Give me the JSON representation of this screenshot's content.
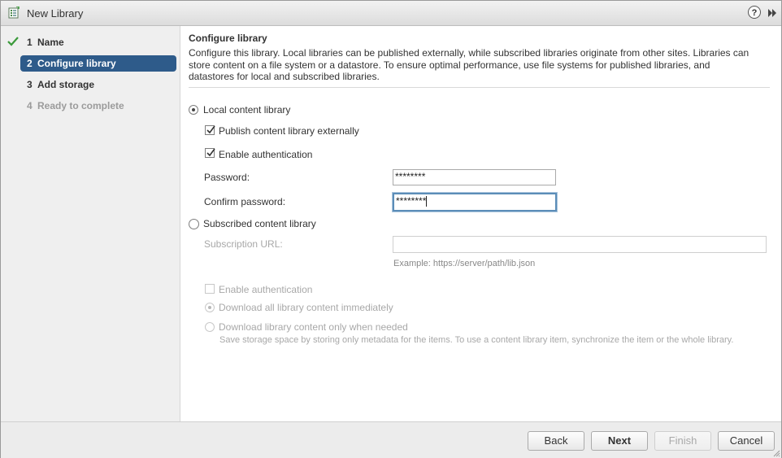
{
  "window": {
    "title": "New Library",
    "help_label": "?"
  },
  "steps": [
    {
      "num": "1",
      "label": "Name"
    },
    {
      "num": "2",
      "label": "Configure library"
    },
    {
      "num": "3",
      "label": "Add storage"
    },
    {
      "num": "4",
      "label": "Ready to complete"
    }
  ],
  "main": {
    "section_title": "Configure library",
    "description": "Configure this library. Local libraries can be published externally, while subscribed libraries originate from other sites. Libraries can store content on a file system or a datastore. To ensure optimal performance, use file systems for published libraries, and datastores for local and subscribed libraries.",
    "local": {
      "label": "Local content library",
      "selected": true,
      "publish_label": "Publish content library externally",
      "publish_checked": true,
      "auth_label": "Enable authentication",
      "auth_checked": true,
      "password_label": "Password:",
      "password_value": "********",
      "confirm_label": "Confirm password:",
      "confirm_value": "********"
    },
    "subscribed": {
      "label": "Subscribed content library",
      "selected": false,
      "url_label": "Subscription URL:",
      "url_value": "",
      "url_example": "Example: https://server/path/lib.json",
      "auth_label": "Enable authentication",
      "download_all_label": "Download all library content immediately",
      "download_all_selected": true,
      "download_needed_label": "Download library content only when needed",
      "download_needed_hint": "Save storage space by storing only metadata for the items. To use a content library item, synchronize the item or the whole library."
    }
  },
  "footer": {
    "back": "Back",
    "next": "Next",
    "finish": "Finish",
    "cancel": "Cancel"
  },
  "colors": {
    "active_step": "#2e5b8a",
    "check": "#3a9a3a",
    "focus_border": "#5b8db8"
  }
}
